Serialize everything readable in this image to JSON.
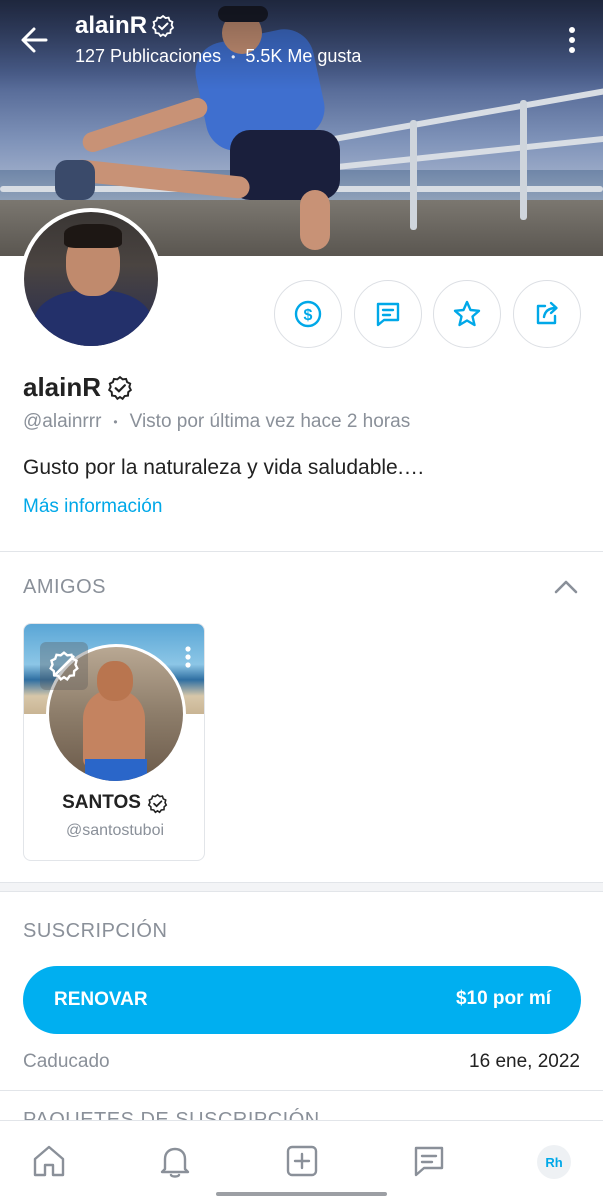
{
  "header": {
    "title": "alainR",
    "posts": "127 Publicaciones",
    "separator": "•",
    "likes": "5.5K Me gusta"
  },
  "actions": [
    {
      "name": "tip",
      "icon": "dollar-icon"
    },
    {
      "name": "message",
      "icon": "message-icon"
    },
    {
      "name": "favorite",
      "icon": "star-icon"
    },
    {
      "name": "share",
      "icon": "share-icon"
    }
  ],
  "profile": {
    "display_name": "alainR",
    "handle": "@alainrrr",
    "separator": "•",
    "last_seen": "Visto por última vez hace 2 horas",
    "bio": "Gusto por la naturaleza y vida saludable.…",
    "more_info": "Más información"
  },
  "friends": {
    "title": "AMIGOS",
    "items": [
      {
        "name": "SANTOS",
        "handle": "@santostuboi"
      }
    ]
  },
  "subscription": {
    "title": "SUSCRIPCIÓN",
    "button_label": "RENOVAR",
    "button_price": "$10 por mí",
    "expired_label": "Caducado",
    "expired_date": "16 ene, 2022",
    "next_section_title": "PAQUETES DE SUSCRIPCIÓN"
  },
  "bottom_nav": {
    "avatar_initials": "Rh"
  },
  "colors": {
    "accent": "#00aff0",
    "link": "#00a8e8",
    "muted": "#8a9099"
  }
}
